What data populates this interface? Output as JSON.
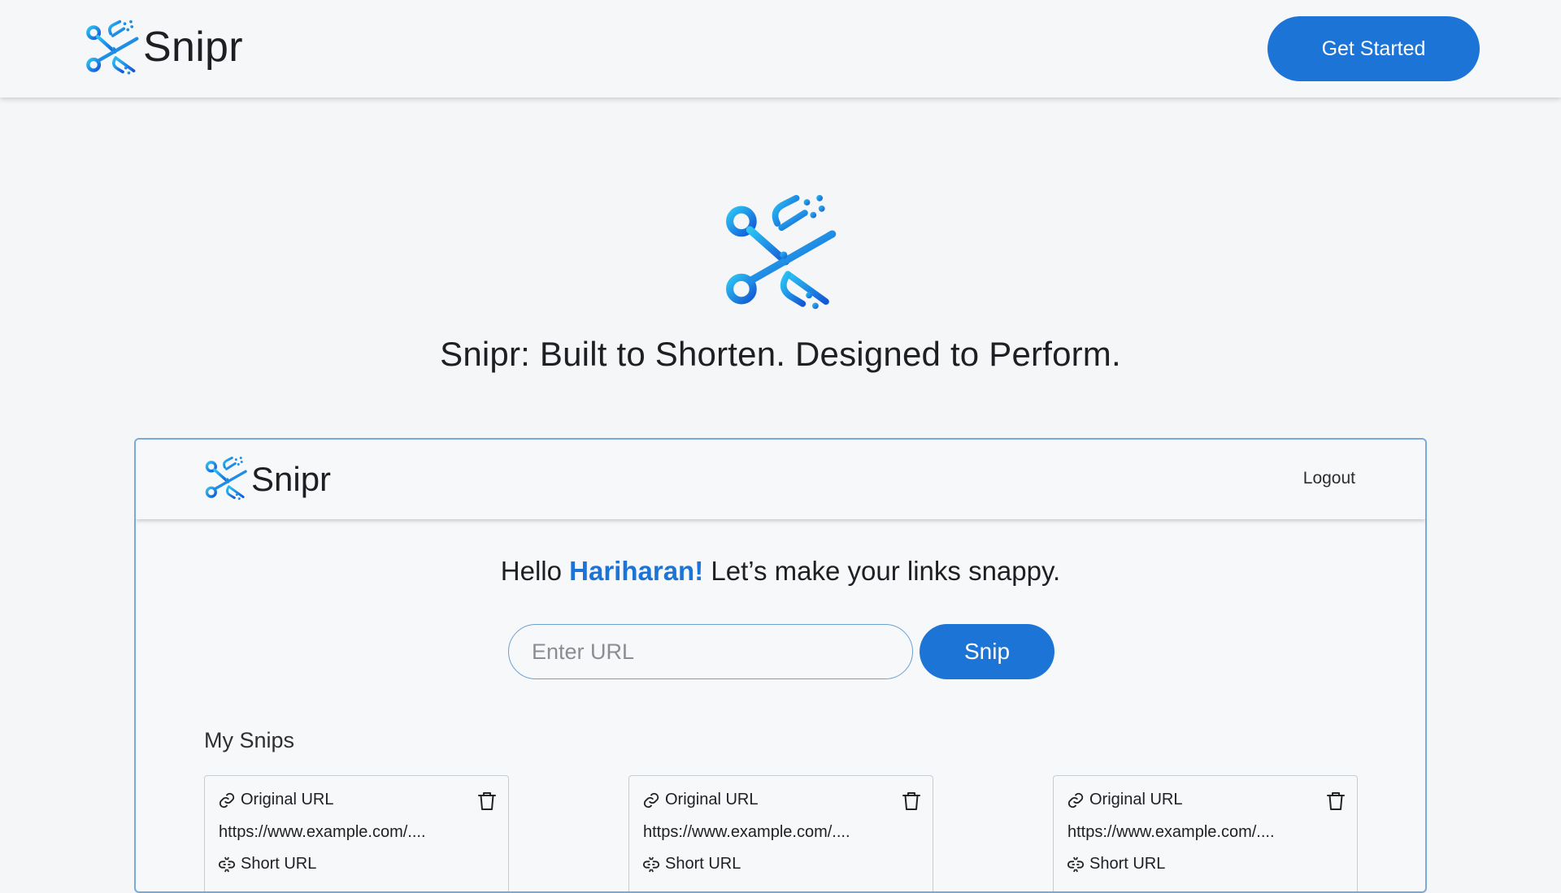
{
  "brand": {
    "name": "Snipr",
    "logo_icon": "snipr-scissors-logo-icon"
  },
  "navbar": {
    "cta_label": "Get Started"
  },
  "hero": {
    "title": "Snipr: Built to Shorten. Designed to Perform."
  },
  "app": {
    "brand_name": "Snipr",
    "logout_label": "Logout",
    "greeting": {
      "prefix": "Hello ",
      "user": "Hariharan!",
      "suffix": " Let’s make your links snappy."
    },
    "url_input": {
      "placeholder": "Enter URL",
      "value": ""
    },
    "snip_label": "Snip",
    "section_title": "My Snips",
    "snips": [
      {
        "original_label": "Original URL",
        "original_url": "https://www.example.com/....",
        "short_label": "Short URL"
      },
      {
        "original_label": "Original URL",
        "original_url": "https://www.example.com/....",
        "short_label": "Short URL"
      },
      {
        "original_label": "Original URL",
        "original_url": "https://www.example.com/....",
        "short_label": "Short URL"
      }
    ]
  },
  "colors": {
    "accent": "#1b74d6",
    "logo_light": "#29b6f0",
    "logo_dark": "#1565d8",
    "frame_border": "#79a9d8"
  },
  "icons": {
    "link": "link-icon",
    "short": "broken-link-icon",
    "delete": "trash-icon"
  }
}
